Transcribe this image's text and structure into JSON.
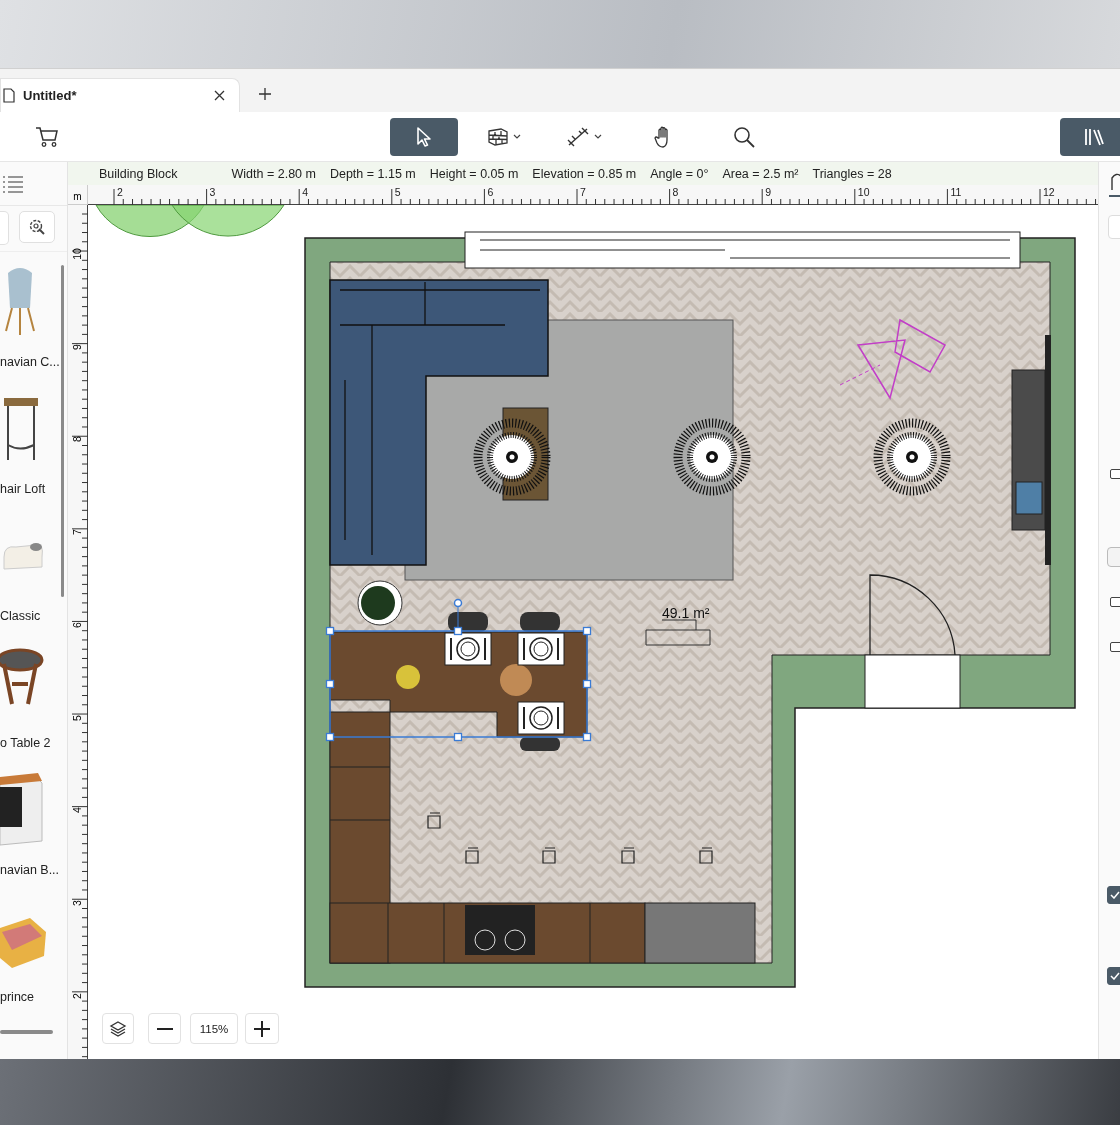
{
  "tabs": [
    {
      "label": "Untitled*",
      "selected": true
    }
  ],
  "toolbar": {
    "tools": [
      {
        "kind": "select",
        "selected": true,
        "dropdown": false
      },
      {
        "kind": "wall",
        "selected": false,
        "dropdown": true
      },
      {
        "kind": "dimension",
        "selected": false,
        "dropdown": true
      },
      {
        "kind": "pan",
        "selected": false,
        "dropdown": false
      },
      {
        "kind": "zoom",
        "selected": false,
        "dropdown": false
      }
    ],
    "library_button": {
      "selected": true
    }
  },
  "catalog": {
    "items": [
      {
        "label": "navian C..."
      },
      {
        "label": "hair Loft"
      },
      {
        "label": "Classic"
      },
      {
        "label": "o Table 2"
      },
      {
        "label": "navian B..."
      },
      {
        "label": "prince"
      }
    ]
  },
  "info_bar": [
    "Building Block",
    "Width = 2.80 m",
    "Depth = 1.15 m",
    "Height = 0.05 m",
    "Elevation = 0.85 m",
    "Angle = 0°",
    "Area = 2.5 m²",
    "Triangles = 28"
  ],
  "ruler": {
    "unit": "m",
    "x_labels": [
      "2",
      "3",
      "4",
      "5",
      "6",
      "7",
      "8",
      "9",
      "10",
      "11",
      "12"
    ],
    "y_labels": [
      "10",
      "9",
      "8",
      "7",
      "6",
      "5",
      "4",
      "3",
      "2"
    ]
  },
  "plan": {
    "room_area": "49.1 m²"
  },
  "right_panel": {
    "checkboxes": [
      {
        "checked": false
      },
      {
        "checked": false
      },
      {
        "checked": false
      },
      {
        "checked": true
      },
      {
        "checked": true
      }
    ]
  },
  "zoom_controls": {
    "value": "115%"
  }
}
